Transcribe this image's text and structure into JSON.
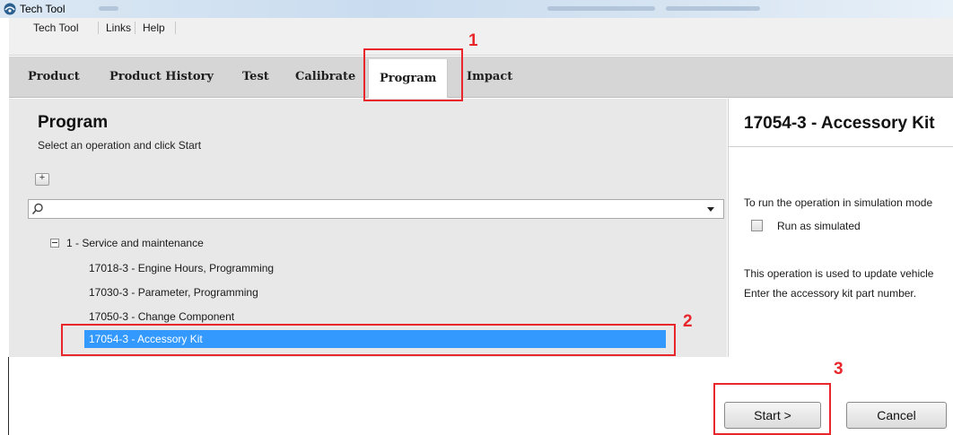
{
  "window": {
    "title": "Tech Tool"
  },
  "menu": {
    "items": [
      "Tech Tool",
      "Links",
      "Help"
    ]
  },
  "tabs": [
    "Product",
    "Product History",
    "Test",
    "Calibrate",
    "Program",
    "Impact"
  ],
  "active_tab": "Program",
  "left_panel": {
    "title": "Program",
    "subtitle": "Select an operation and click Start",
    "expand_symbol": "+",
    "search": {
      "value": "",
      "placeholder": ""
    },
    "tree": {
      "group_label": "1 - Service and maintenance",
      "items": [
        "17018-3 - Engine Hours, Programming",
        "17030-3 - Parameter, Programming",
        "17050-3 - Change Component",
        "17054-3 - Accessory Kit"
      ],
      "selected_index": 3
    }
  },
  "right_panel": {
    "title": "17054-3 - Accessory Kit",
    "simulation_text": "To run the operation in simulation mode",
    "checkbox_label": "Run as simulated",
    "description": "This operation is used to update vehicle",
    "instruction": "Enter the accessory kit part number."
  },
  "buttons": {
    "start": "Start >",
    "cancel": "Cancel"
  },
  "annotations": [
    "1",
    "2",
    "3"
  ],
  "colors": {
    "selection": "#3399ff",
    "annotation": "#e8262b",
    "tabbar": "#d6d6d6",
    "panel": "#e8e8e8"
  },
  "icons": [
    "app-logo-icon",
    "search-icon",
    "dropdown-arrow-icon",
    "expand-all-icon",
    "tree-collapse-icon"
  ]
}
